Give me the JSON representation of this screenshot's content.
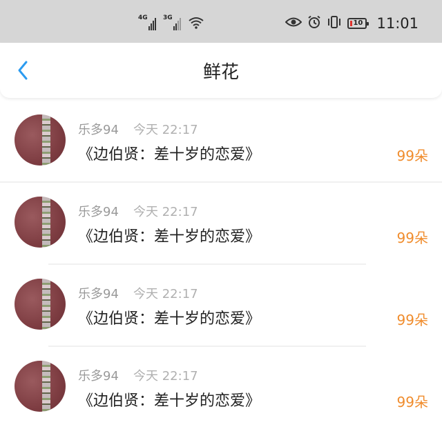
{
  "status_bar": {
    "network_1": "4G",
    "network_2": "3G",
    "battery_level": "10",
    "time": "11:01",
    "icons": [
      "signal-icon",
      "wifi-icon",
      "eye-icon",
      "alarm-icon",
      "vibrate-icon",
      "battery-icon"
    ]
  },
  "header": {
    "back_icon": "chevron-left-icon",
    "title": "鲜花"
  },
  "items": [
    {
      "username": "乐多94",
      "time": "今天 22:17",
      "title": "《边伯贤：差十岁的恋爱》",
      "count": "99朵"
    },
    {
      "username": "乐多94",
      "time": "今天 22:17",
      "title": "《边伯贤：差十岁的恋爱》",
      "count": "99朵"
    },
    {
      "username": "乐多94",
      "time": "今天 22:17",
      "title": "《边伯贤：差十岁的恋爱》",
      "count": "99朵"
    },
    {
      "username": "乐多94",
      "time": "今天 22:17",
      "title": "《边伯贤：差十岁的恋爱》",
      "count": "99朵"
    }
  ],
  "colors": {
    "status_bar_bg": "#d6d6d6",
    "accent_blue": "#2b9bf0",
    "count_orange": "#f08c2c",
    "battery_low": "#e0332e"
  }
}
